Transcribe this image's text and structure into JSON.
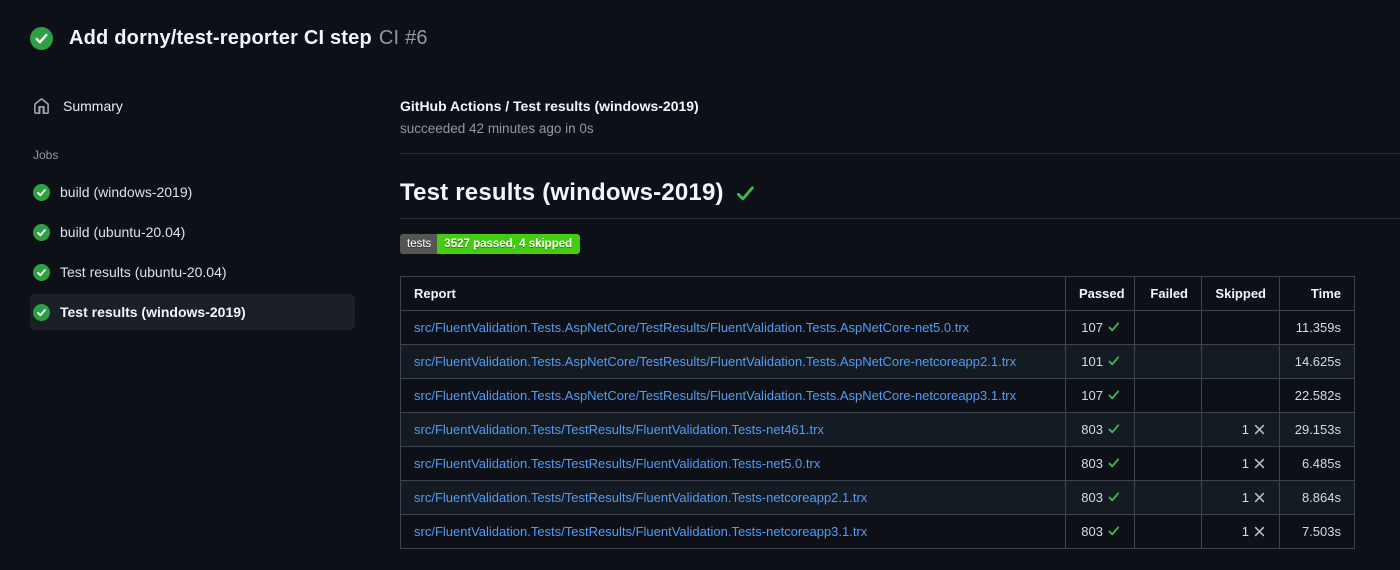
{
  "header": {
    "title": "Add dorny/test-reporter CI step",
    "run_number": "CI #6"
  },
  "sidebar": {
    "summary_label": "Summary",
    "jobs_label": "Jobs",
    "jobs": [
      {
        "label": "build (windows-2019)",
        "status": "success",
        "selected": false
      },
      {
        "label": "build (ubuntu-20.04)",
        "status": "success",
        "selected": false
      },
      {
        "label": "Test results (ubuntu-20.04)",
        "status": "success",
        "selected": false
      },
      {
        "label": "Test results (windows-2019)",
        "status": "success",
        "selected": true
      }
    ]
  },
  "main": {
    "check_title": "GitHub Actions / Test results (windows-2019)",
    "check_status": "succeeded 42 minutes ago in 0s",
    "section_title": "Test results (windows-2019)",
    "badge": {
      "label": "tests",
      "value": "3527 passed, 4 skipped",
      "label_bg": "#555555",
      "value_bg": "#44cc11"
    },
    "table": {
      "columns": [
        "Report",
        "Passed",
        "Failed",
        "Skipped",
        "Time"
      ],
      "rows": [
        {
          "report": "src/FluentValidation.Tests.AspNetCore/TestResults/FluentValidation.Tests.AspNetCore-net5.0.trx",
          "passed": "107",
          "failed": "",
          "skipped": "",
          "time": "11.359s"
        },
        {
          "report": "src/FluentValidation.Tests.AspNetCore/TestResults/FluentValidation.Tests.AspNetCore-netcoreapp2.1.trx",
          "passed": "101",
          "failed": "",
          "skipped": "",
          "time": "14.625s"
        },
        {
          "report": "src/FluentValidation.Tests.AspNetCore/TestResults/FluentValidation.Tests.AspNetCore-netcoreapp3.1.trx",
          "passed": "107",
          "failed": "",
          "skipped": "",
          "time": "22.582s"
        },
        {
          "report": "src/FluentValidation.Tests/TestResults/FluentValidation.Tests-net461.trx",
          "passed": "803",
          "failed": "",
          "skipped": "1",
          "time": "29.153s"
        },
        {
          "report": "src/FluentValidation.Tests/TestResults/FluentValidation.Tests-net5.0.trx",
          "passed": "803",
          "failed": "",
          "skipped": "1",
          "time": "6.485s"
        },
        {
          "report": "src/FluentValidation.Tests/TestResults/FluentValidation.Tests-netcoreapp2.1.trx",
          "passed": "803",
          "failed": "",
          "skipped": "1",
          "time": "8.864s"
        },
        {
          "report": "src/FluentValidation.Tests/TestResults/FluentValidation.Tests-netcoreapp3.1.trx",
          "passed": "803",
          "failed": "",
          "skipped": "1",
          "time": "7.503s"
        }
      ]
    }
  },
  "colors": {
    "page_bg": "#0d1117",
    "row_alt_bg": "#151b23",
    "table_border": "#3d444d",
    "link_blue": "#539bf5",
    "success_green": "#2ea043",
    "check_green": "#3fb950",
    "skipped_gray": "#b3bac4",
    "muted_text": "#9198a1"
  }
}
